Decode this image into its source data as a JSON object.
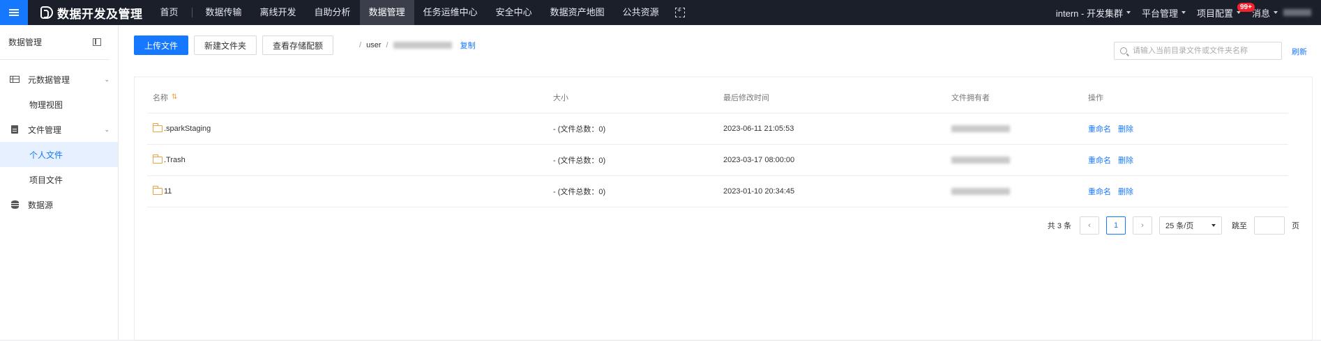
{
  "topbar": {
    "brand": "数据开发及管理",
    "nav": [
      {
        "label": "首页"
      },
      {
        "label": "数据传输"
      },
      {
        "label": "离线开发"
      },
      {
        "label": "自助分析"
      },
      {
        "label": "数据管理"
      },
      {
        "label": "任务运维中心"
      },
      {
        "label": "安全中心"
      },
      {
        "label": "数据资产地图"
      },
      {
        "label": "公共资源"
      }
    ],
    "active_nav": "数据管理",
    "cluster": "intern - 开发集群",
    "platform_admin": "平台管理",
    "project_config": "项目配置",
    "messages": "消息",
    "message_badge": "99+"
  },
  "sidebar": {
    "title": "数据管理",
    "items": [
      {
        "label": "元数据管理",
        "icon": "table-icon"
      },
      {
        "label": "物理视图"
      },
      {
        "label": "文件管理",
        "icon": "file-icon"
      },
      {
        "label": "个人文件"
      },
      {
        "label": "项目文件"
      },
      {
        "label": "数据源",
        "icon": "database-icon"
      }
    ],
    "active_item": "个人文件"
  },
  "toolbar": {
    "upload": "上传文件",
    "new_folder": "新建文件夹",
    "view_quota": "查看存储配额",
    "path_root": "user",
    "copy": "复制"
  },
  "search": {
    "placeholder": "请输入当前目录文件或文件夹名称"
  },
  "refresh": "刷新",
  "table": {
    "columns": [
      "名称",
      "大小",
      "最后修改时间",
      "文件拥有者",
      "操作"
    ],
    "rows": [
      {
        "name": ".sparkStaging",
        "size": "- (文件总数：0)",
        "mtime": "2023-06-11 21:05:53"
      },
      {
        "name": ".Trash",
        "size": "- (文件总数：0)",
        "mtime": "2023-03-17 08:00:00"
      },
      {
        "name": "11",
        "size": "- (文件总数：0)",
        "mtime": "2023-01-10 20:34:45"
      }
    ],
    "rename": "重命名",
    "delete": "删除"
  },
  "pagination": {
    "total": "共 3 条",
    "current_page": "1",
    "page_size": "25 条/页",
    "jump_label": "跳至",
    "page_unit": "页"
  },
  "colors": {
    "primary": "#1677ff",
    "topbar_bg": "#1b1f2a",
    "folder": "#f0a03c",
    "badge": "#f5222d"
  }
}
